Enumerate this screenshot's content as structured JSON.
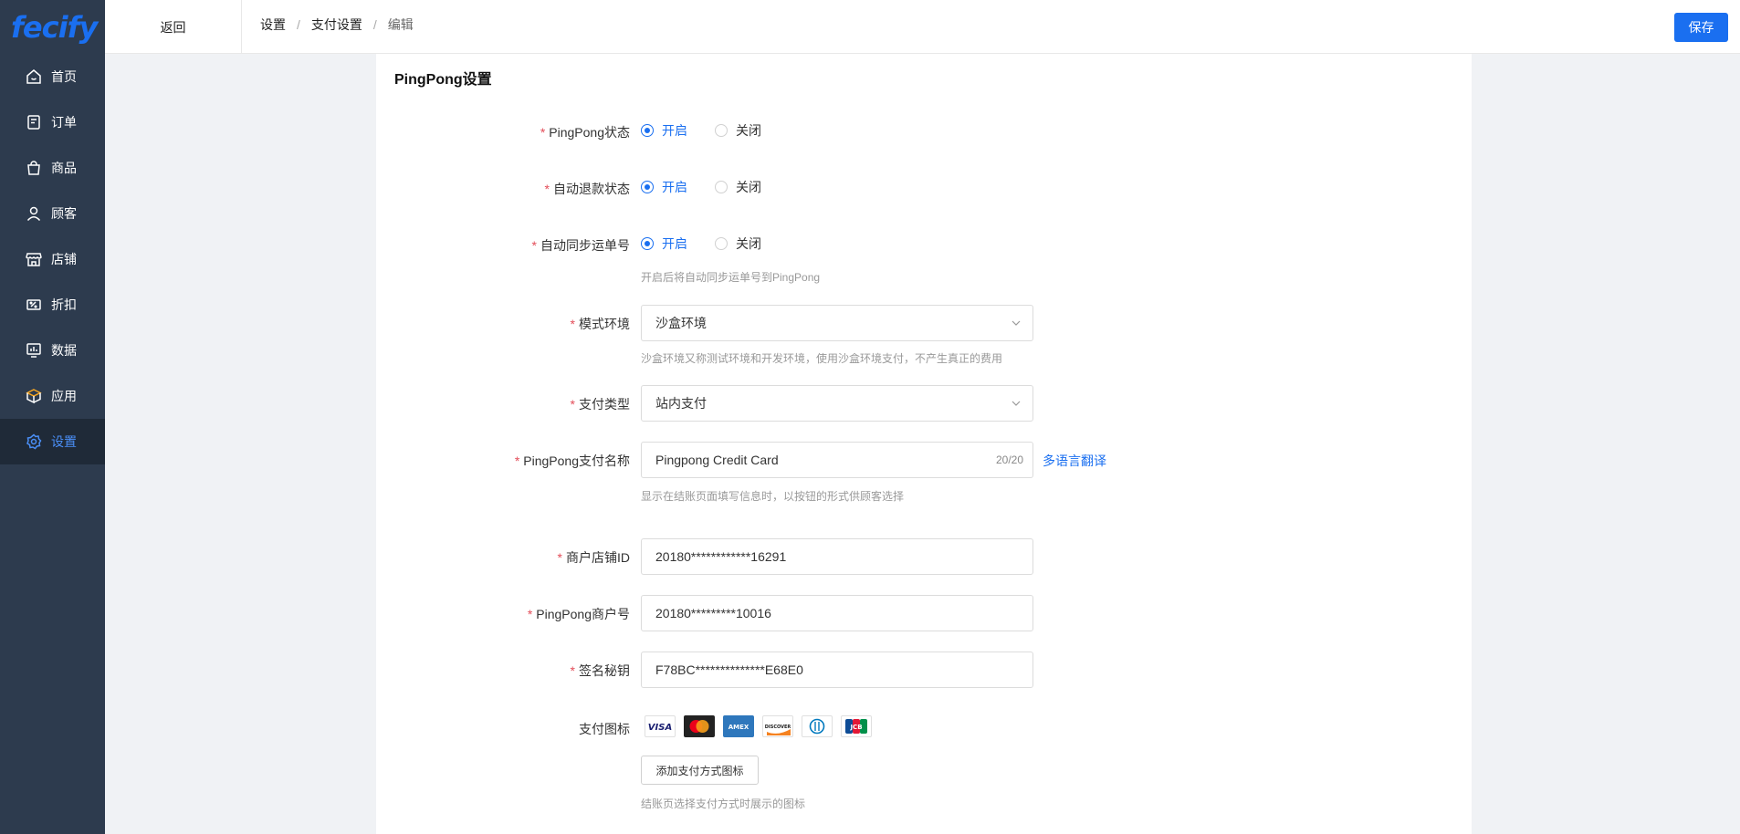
{
  "brand": {
    "logo_text": "fecify"
  },
  "sidebar": {
    "items": [
      {
        "label": "首页",
        "icon": "home-icon"
      },
      {
        "label": "订单",
        "icon": "order-icon"
      },
      {
        "label": "商品",
        "icon": "bag-icon"
      },
      {
        "label": "顾客",
        "icon": "user-icon"
      },
      {
        "label": "店铺",
        "icon": "store-icon"
      },
      {
        "label": "折扣",
        "icon": "discount-icon"
      },
      {
        "label": "数据",
        "icon": "chart-icon"
      },
      {
        "label": "应用",
        "icon": "box-icon"
      },
      {
        "label": "设置",
        "icon": "gear-icon",
        "active": true
      }
    ]
  },
  "topbar": {
    "back_label": "返回",
    "breadcrumb": [
      "设置",
      "支付设置",
      "编辑"
    ],
    "save_label": "保存"
  },
  "form": {
    "title": "PingPong设置",
    "status": {
      "label": "PingPong状态",
      "options": [
        "开启",
        "关闭"
      ],
      "selected": "开启"
    },
    "auto_refund": {
      "label": "自动退款状态",
      "options": [
        "开启",
        "关闭"
      ],
      "selected": "开启"
    },
    "auto_sync": {
      "label": "自动同步运单号",
      "options": [
        "开启",
        "关闭"
      ],
      "selected": "开启",
      "hint": "开启后将自动同步运单号到PingPong"
    },
    "mode_env": {
      "label": "模式环境",
      "value": "沙盒环境",
      "hint": "沙盒环境又称测试环境和开发环境，使用沙盒环境支付，不产生真正的费用"
    },
    "pay_type": {
      "label": "支付类型",
      "value": "站内支付"
    },
    "pay_name": {
      "label": "PingPong支付名称",
      "value": "Pingpong Credit Card",
      "count": "20/20",
      "link": "多语言翻译",
      "hint": "显示在结账页面填写信息时，以按钮的形式供顾客选择"
    },
    "store_id": {
      "label": "商户店铺ID",
      "value": "20180************16291"
    },
    "merchant_no": {
      "label": "PingPong商户号",
      "value": "20180*********10016"
    },
    "sign_key": {
      "label": "签名秘钥",
      "value": "F78BC**************E68E0"
    },
    "pay_icons": {
      "label": "支付图标",
      "cards": [
        "VISA",
        "Mastercard",
        "AMEX",
        "DISCOVER",
        "Diners",
        "JCB"
      ],
      "add_label": "添加支付方式图标",
      "hint": "结账页选择支付方式时展示的图标"
    }
  },
  "colors": {
    "accent": "#1a6ff0",
    "sidebar_bg": "#2d3b4e",
    "required": "#e34d59"
  }
}
